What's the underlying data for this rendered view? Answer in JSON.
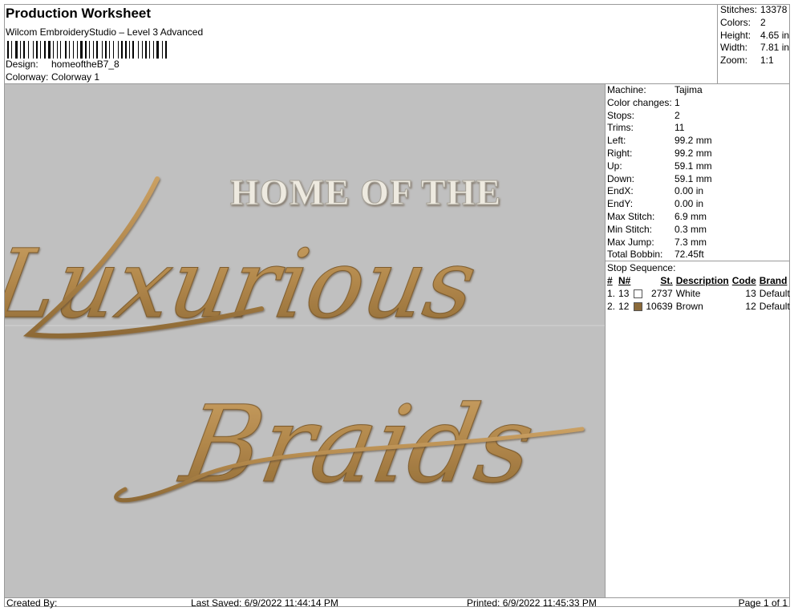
{
  "header": {
    "title": "Production Worksheet",
    "subtitle": "Wilcom EmbroideryStudio – Level 3 Advanced",
    "design_label": "Design:",
    "design_value": "homeoftheB7_8",
    "colorway_label": "Colorway:",
    "colorway_value": "Colorway 1"
  },
  "stats": [
    {
      "label": "Stitches:",
      "value": "13378"
    },
    {
      "label": "Colors:",
      "value": "2"
    },
    {
      "label": "Height:",
      "value": "4.65 in"
    },
    {
      "label": "Width:",
      "value": "7.81 in"
    },
    {
      "label": "Zoom:",
      "value": "1:1"
    }
  ],
  "machine_info": [
    {
      "label": "Machine:",
      "value": "Tajima"
    },
    {
      "label": "Color changes:",
      "value": "1"
    },
    {
      "label": "Stops:",
      "value": "2"
    },
    {
      "label": "Trims:",
      "value": "11"
    },
    {
      "label": "Left:",
      "value": "99.2 mm"
    },
    {
      "label": "Right:",
      "value": "99.2 mm"
    },
    {
      "label": "Up:",
      "value": "59.1 mm"
    },
    {
      "label": "Down:",
      "value": "59.1 mm"
    },
    {
      "label": "EndX:",
      "value": "0.00 in"
    },
    {
      "label": "EndY:",
      "value": "0.00 in"
    },
    {
      "label": "Max Stitch:",
      "value": "6.9 mm"
    },
    {
      "label": "Min Stitch:",
      "value": "0.3 mm"
    },
    {
      "label": "Max Jump:",
      "value": "7.3 mm"
    },
    {
      "label": "Total Bobbin:",
      "value": "72.45ft"
    }
  ],
  "stop_sequence": {
    "title": "Stop Sequence:",
    "headers": {
      "num": "#",
      "needle": "N#",
      "stitches": "St.",
      "description": "Description",
      "code": "Code",
      "brand": "Brand"
    },
    "rows": [
      {
        "num": "1.",
        "needle": "13",
        "color": "#ffffff",
        "stitches": "2737",
        "description": "White",
        "code": "13",
        "brand": "Default"
      },
      {
        "num": "2.",
        "needle": "12",
        "color": "#8b6a3a",
        "stitches": "10639",
        "description": "Brown",
        "code": "12",
        "brand": "Default"
      }
    ]
  },
  "design_text": {
    "line1": "HOME OF THE",
    "line2": "Luxurious",
    "line3": "Braids"
  },
  "footer": {
    "created_by": "Created By:",
    "last_saved": "Last Saved: 6/9/2022 11:44:14 PM",
    "printed": "Printed: 6/9/2022 11:45:33 PM",
    "page": "Page 1 of 1"
  },
  "colors": {
    "design_bg": "#c0c0c0",
    "white_thread": "#f0ede4",
    "brown_thread": "#b5894a"
  }
}
